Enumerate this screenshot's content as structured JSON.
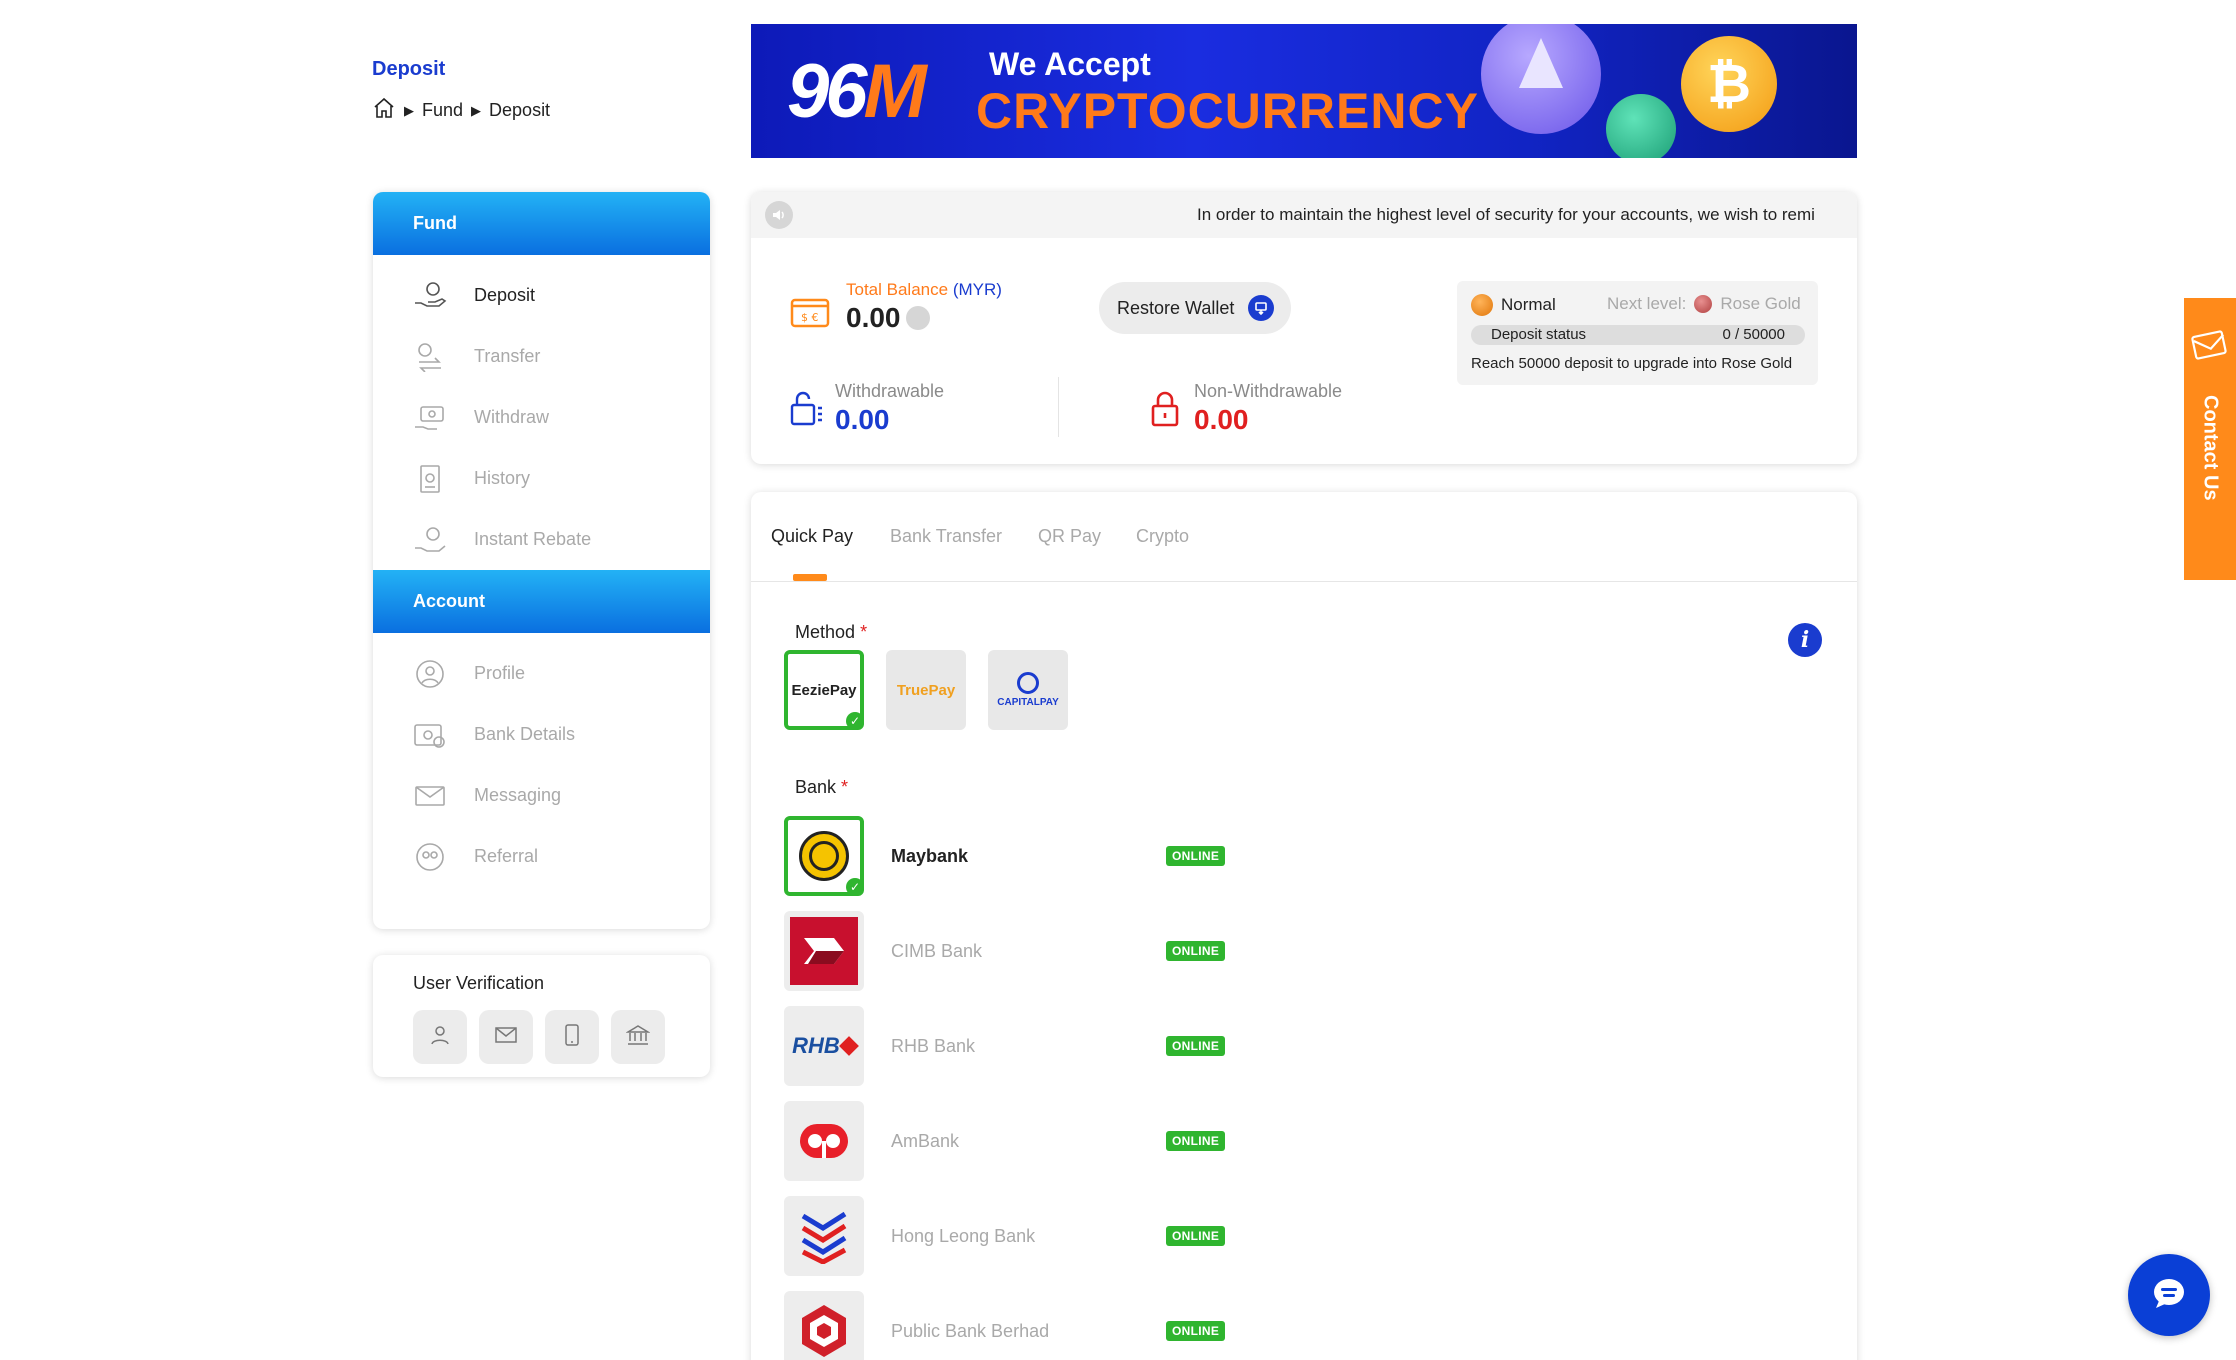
{
  "header": {
    "title": "Deposit",
    "breadcrumb": [
      "Fund",
      "Deposit"
    ]
  },
  "banner": {
    "logo_num": "96",
    "logo_m": "M",
    "line1": "We Accept",
    "line2": "CRYPTOCURRENCY"
  },
  "sidebar": {
    "fund_heading": "Fund",
    "fund_items": [
      {
        "label": "Deposit",
        "icon": "deposit-icon"
      },
      {
        "label": "Transfer",
        "icon": "transfer-icon"
      },
      {
        "label": "Withdraw",
        "icon": "withdraw-icon"
      },
      {
        "label": "History",
        "icon": "history-icon"
      },
      {
        "label": "Instant Rebate",
        "icon": "rebate-icon"
      }
    ],
    "account_heading": "Account",
    "account_items": [
      {
        "label": "Profile",
        "icon": "profile-icon"
      },
      {
        "label": "Bank Details",
        "icon": "bank-details-icon"
      },
      {
        "label": "Messaging",
        "icon": "messaging-icon"
      },
      {
        "label": "Referral",
        "icon": "referral-icon"
      }
    ]
  },
  "verification": {
    "title": "User Verification",
    "icons": [
      "user-icon",
      "email-icon",
      "phone-icon",
      "bank-icon"
    ]
  },
  "notice": {
    "text": "In order to maintain the highest level of security for your accounts, we wish to remi"
  },
  "balance": {
    "total_label": "Total Balance",
    "currency": "(MYR)",
    "total_value": "0.00",
    "withdrawable_label": "Withdrawable",
    "withdrawable_value": "0.00",
    "non_withdrawable_label": "Non-Withdrawable",
    "non_withdrawable_value": "0.00",
    "restore_label": "Restore Wallet"
  },
  "level": {
    "current": "Normal",
    "next_label": "Next level:",
    "next": "Rose Gold",
    "status_label": "Deposit status",
    "status_value": "0 / 50000",
    "progress": 0,
    "message": "Reach 50000 deposit to upgrade into Rose Gold"
  },
  "tabs": [
    "Quick Pay",
    "Bank Transfer",
    "QR Pay",
    "Crypto"
  ],
  "method": {
    "label": "Method",
    "options": [
      "EeziePay",
      "TruePay",
      "CAPITALPAY"
    ],
    "selected": 0
  },
  "bank": {
    "label": "Bank",
    "list": [
      {
        "name": "Maybank",
        "status": "ONLINE"
      },
      {
        "name": "CIMB Bank",
        "status": "ONLINE"
      },
      {
        "name": "RHB Bank",
        "status": "ONLINE"
      },
      {
        "name": "AmBank",
        "status": "ONLINE"
      },
      {
        "name": "Hong Leong Bank",
        "status": "ONLINE"
      },
      {
        "name": "Public Bank Berhad",
        "status": "ONLINE"
      }
    ],
    "selected": 0,
    "rhb_logo": "RHB"
  },
  "contact": {
    "label": "Contact Us"
  },
  "colors": {
    "accent": "#1a3ccf",
    "orange": "#ff8a1a",
    "online": "#2fb52f",
    "red": "#e02020"
  }
}
